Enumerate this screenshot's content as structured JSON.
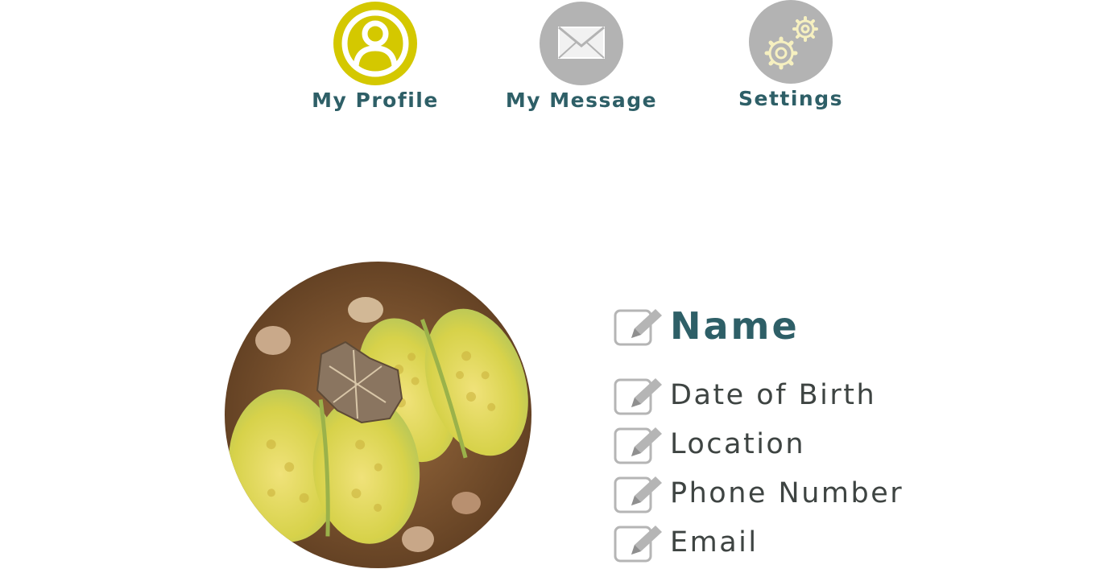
{
  "nav": {
    "items": [
      {
        "label": "My Profile",
        "icon": "profile-icon",
        "color": "#d4c800",
        "active": true
      },
      {
        "label": "My Message",
        "icon": "envelope-icon",
        "color": "#b3b3b3",
        "active": false
      },
      {
        "label": "Settings",
        "icon": "gears-icon",
        "color": "#b3b3b3",
        "active": false
      }
    ]
  },
  "profile": {
    "avatar": "lithops-plant-photo",
    "fields": [
      {
        "label": "Name",
        "icon": "edit-icon"
      },
      {
        "label": "Date of Birth",
        "icon": "edit-icon"
      },
      {
        "label": "Location",
        "icon": "edit-icon"
      },
      {
        "label": "Phone Number",
        "icon": "edit-icon"
      },
      {
        "label": "Email",
        "icon": "edit-icon"
      }
    ]
  },
  "colors": {
    "accent": "#d4c800",
    "inactive": "#b3b3b3",
    "heading": "#2e5f67",
    "text": "#3e4442"
  }
}
